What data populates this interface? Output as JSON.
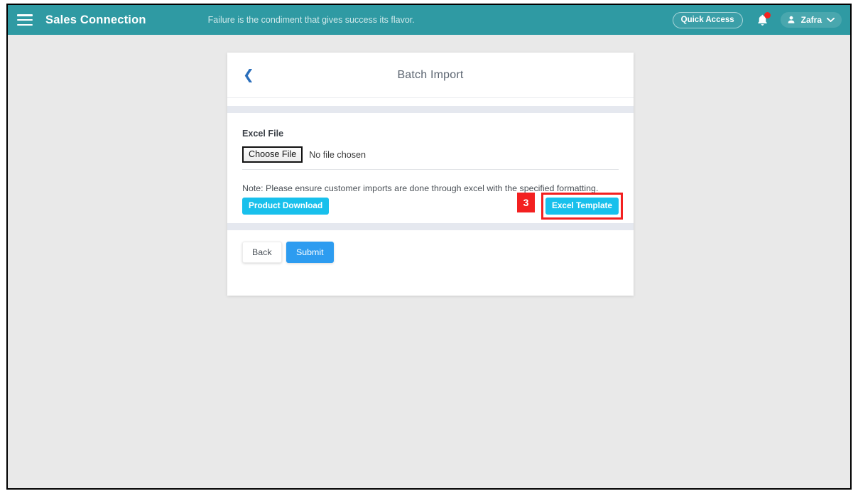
{
  "navbar": {
    "menu_icon": "hamburger-icon",
    "brand": "Sales Connection",
    "quote": "Failure is the condiment that gives success its flavor.",
    "quick_access_label": "Quick Access",
    "bell_icon": "notification-bell-icon",
    "user_name": "Zafra",
    "user_icon": "user-avatar-icon",
    "chevron_icon": "chevron-down-icon",
    "bg_color": "#2f9aa3"
  },
  "card": {
    "back_icon": "chevron-left-icon",
    "title": "Batch Import",
    "form": {
      "field_label": "Excel File",
      "choose_file_label": "Choose File",
      "no_file_text": "No file chosen",
      "note": "Note: Please ensure customer imports are done through excel with the specified formatting.",
      "product_download_label": "Product Download",
      "excel_template_label": "Excel Template"
    },
    "footer": {
      "back_label": "Back",
      "submit_label": "Submit"
    }
  },
  "annotation": {
    "step_number": "3",
    "color": "#f32020",
    "target": "excel-template-button"
  },
  "colors": {
    "brand_teal": "#2f9aa3",
    "info_blue": "#18c0ec",
    "primary_blue": "#2d9cf0",
    "page_bg": "#e9e9e9",
    "band": "#e5e8ef"
  }
}
